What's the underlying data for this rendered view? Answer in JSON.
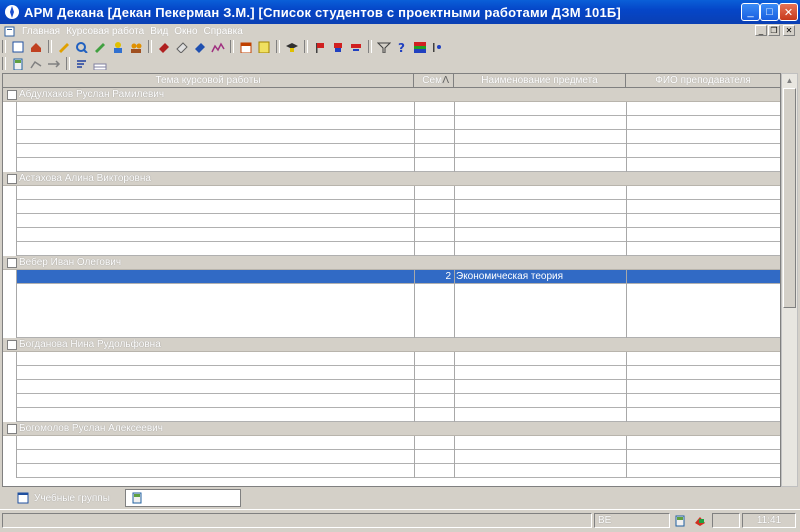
{
  "window": {
    "title": "АРМ Декана [Декан Пекерман З.М.]  [Список студентов с проектными работами ДЗМ 101Б]",
    "controls": {
      "minimize": "_",
      "maximize": "□",
      "close": "✕"
    },
    "mdi_controls": {
      "minimize": "_",
      "restore": "❐",
      "close": "✕"
    }
  },
  "menu": [
    "Главная",
    "Курсовая работа",
    "Вид",
    "Окно",
    "Справка"
  ],
  "grid": {
    "columns": [
      "Тема курсовой работы",
      "Сем.",
      "Наименование предмета",
      "ФИО преподавателя"
    ],
    "sort_indicator": "Λ",
    "groups": [
      {
        "name": "Абдулхаков Руслан Рамилевич",
        "rows": [
          {
            "theme": "",
            "sem": "",
            "subject": "",
            "teacher": ""
          },
          {
            "theme": "",
            "sem": "",
            "subject": "",
            "teacher": ""
          },
          {
            "theme": "",
            "sem": "",
            "subject": "",
            "teacher": ""
          },
          {
            "theme": "",
            "sem": "",
            "subject": "",
            "teacher": ""
          },
          {
            "theme": "",
            "sem": "",
            "subject": "",
            "teacher": ""
          }
        ]
      },
      {
        "name": "Астахова Алина Викторовна",
        "rows": [
          {
            "theme": "",
            "sem": "",
            "subject": "",
            "teacher": ""
          },
          {
            "theme": "",
            "sem": "",
            "subject": "",
            "teacher": ""
          },
          {
            "theme": "",
            "sem": "",
            "subject": "",
            "teacher": ""
          },
          {
            "theme": "",
            "sem": "",
            "subject": "",
            "teacher": ""
          },
          {
            "theme": "",
            "sem": "",
            "subject": "",
            "teacher": ""
          }
        ]
      },
      {
        "name": "Вебер Иван Олегович",
        "rows": [
          {
            "theme": "",
            "sem": "2",
            "subject": "Экономическая теория",
            "teacher": "",
            "selected": true
          },
          {
            "theme": "",
            "sem": "",
            "subject": "",
            "teacher": "",
            "tall": true
          }
        ]
      },
      {
        "name": "Богданова Нина Рудольфовна",
        "rows": [
          {
            "theme": "",
            "sem": "",
            "subject": "",
            "teacher": ""
          },
          {
            "theme": "",
            "sem": "",
            "subject": "",
            "teacher": ""
          },
          {
            "theme": "",
            "sem": "",
            "subject": "",
            "teacher": ""
          },
          {
            "theme": "",
            "sem": "",
            "subject": "",
            "teacher": ""
          },
          {
            "theme": "",
            "sem": "",
            "subject": "",
            "teacher": ""
          }
        ]
      },
      {
        "name": "Богомолов Руслан Алексеевич",
        "rows": [
          {
            "theme": "",
            "sem": "",
            "subject": "",
            "teacher": ""
          },
          {
            "theme": "",
            "sem": "",
            "subject": "",
            "teacher": ""
          },
          {
            "theme": "",
            "sem": "",
            "subject": "",
            "teacher": ""
          }
        ]
      }
    ]
  },
  "tabs": [
    {
      "label": "Учебные группы",
      "active": false
    },
    {
      "label": "",
      "active": true
    }
  ],
  "status": {
    "mode": "ВЕ",
    "time": "11:41"
  }
}
